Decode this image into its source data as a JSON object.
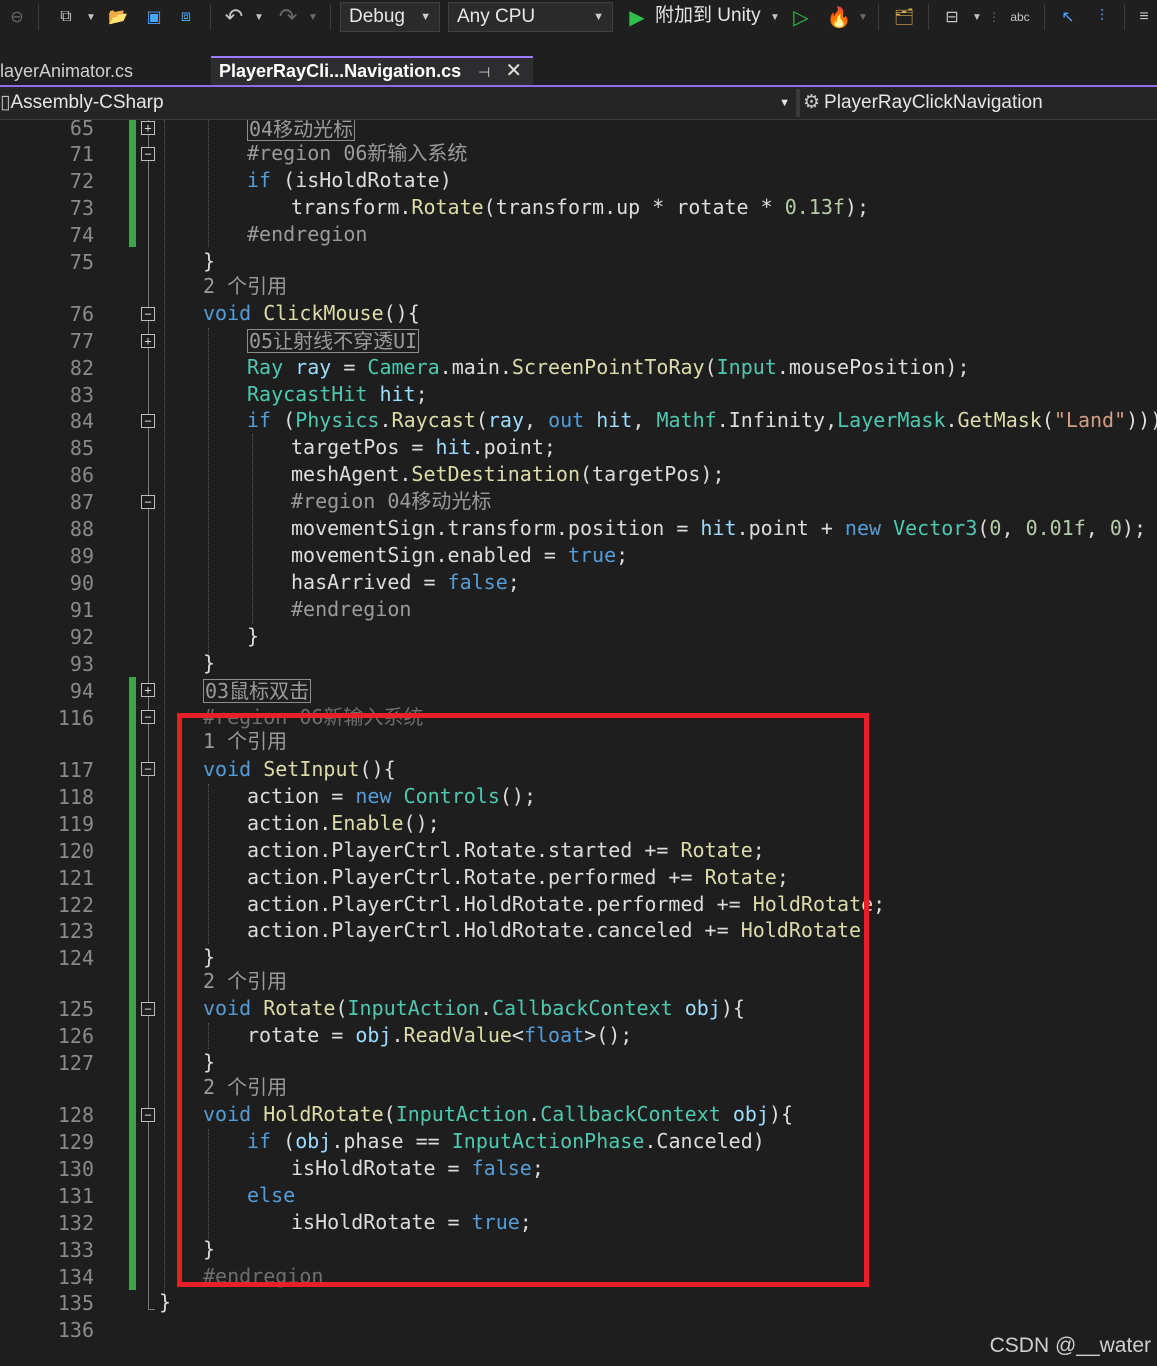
{
  "toolbar": {
    "config": "Debug",
    "platform": "Any CPU",
    "attach_label": "附加到 Unity"
  },
  "tabs": [
    {
      "label": "layerAnimator.cs",
      "active": false
    },
    {
      "label": "PlayerRayCli...Navigation.cs",
      "active": true
    }
  ],
  "navbar": {
    "project": "Assembly-CSharp",
    "class": "PlayerRayClickNavigation"
  },
  "line_numbers": [
    "65",
    "71",
    "72",
    "73",
    "74",
    "75",
    "76",
    "77",
    "82",
    "83",
    "84",
    "85",
    "86",
    "87",
    "88",
    "89",
    "90",
    "91",
    "92",
    "93",
    "94",
    "116",
    "117",
    "118",
    "119",
    "120",
    "121",
    "122",
    "123",
    "124",
    "125",
    "126",
    "127",
    "128",
    "129",
    "130",
    "131",
    "132",
    "133",
    "134",
    "135",
    "136"
  ],
  "code": {
    "collapsed_65": "04移动光标",
    "l71": "#region 06新输入系统",
    "l72": "if (isHoldRotate)",
    "l73": "transform.Rotate(transform.up * rotate * 0.13f);",
    "l74": "#endregion",
    "l75": "}",
    "lens_76": "2 个引用",
    "l76": "void ClickMouse(){",
    "collapsed_77": "05让射线不穿透UI",
    "l82": "Ray ray = Camera.main.ScreenPointToRay(Input.mousePosition);",
    "l83": "RaycastHit hit;",
    "l84": "if (Physics.Raycast(ray, out hit, Mathf.Infinity,LayerMask.GetMask(\"Land\"))){",
    "l85": "targetPos = hit.point;",
    "l86": "meshAgent.SetDestination(targetPos);",
    "l87": "#region 04移动光标",
    "l88": "movementSign.transform.position = hit.point + new Vector3(0, 0.01f, 0);",
    "l89": "movementSign.enabled = true;",
    "l90": "hasArrived = false;",
    "l91": "#endregion",
    "l92": "}",
    "l93": "}",
    "collapsed_94": "03鼠标双击",
    "l116": "#region 06新输入系统",
    "lens_117": "1 个引用",
    "l117": "void SetInput(){",
    "l118": "action = new Controls();",
    "l119": "action.Enable();",
    "l120": "action.PlayerCtrl.Rotate.started += Rotate;",
    "l121": "action.PlayerCtrl.Rotate.performed += Rotate;",
    "l122": "action.PlayerCtrl.HoldRotate.performed += HoldRotate;",
    "l123": "action.PlayerCtrl.HoldRotate.canceled += HoldRotate;",
    "l124": "}",
    "lens_125": "2 个引用",
    "l125": "void Rotate(InputAction.CallbackContext obj){",
    "l126": "rotate = obj.ReadValue<float>();",
    "l127": "}",
    "lens_128": "2 个引用",
    "l128": "void HoldRotate(InputAction.CallbackContext obj){",
    "l129": "if (obj.phase == InputActionPhase.Canceled)",
    "l130": "isHoldRotate = false;",
    "l131": "else",
    "l132": "isHoldRotate = true;",
    "l133": "}",
    "l134": "#endregion",
    "l135": "}"
  },
  "colors": {
    "keyword": "#569cd6",
    "type": "#4ec9b0",
    "method": "#dcdcaa",
    "highlight_box": "#e8202a",
    "change_bar": "#3fa34a"
  },
  "watermark": "CSDN @__water"
}
